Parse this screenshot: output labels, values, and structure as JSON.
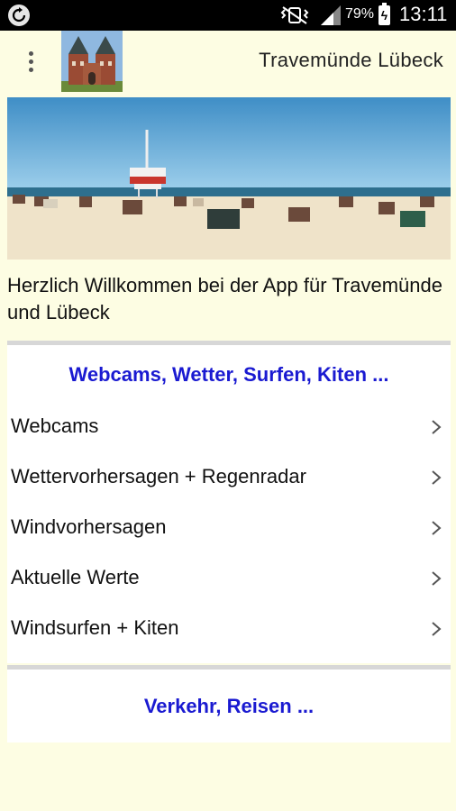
{
  "status_bar": {
    "app_icon": "sync-icon",
    "mute_icon": "vibrate-mute-icon",
    "signal_icon": "signal-icon",
    "battery_percent": "79%",
    "time": "13:11"
  },
  "app_bar": {
    "menu_icon": "overflow-menu-icon",
    "logo_image": "holstentor-logo",
    "title": "Travemünde Lübeck"
  },
  "hero": {
    "image": "beach-with-lifeguard-tower"
  },
  "welcome_text": "Herzlich Willkommen bei der App für Travemünde und Lübeck",
  "sections": [
    {
      "title": "Webcams, Wetter, Surfen, Kiten ...",
      "items": [
        {
          "label": "Webcams"
        },
        {
          "label": "Wettervorhersagen + Regenradar"
        },
        {
          "label": "Windvorhersagen"
        },
        {
          "label": "Aktuelle Werte"
        },
        {
          "label": "Windsurfen + Kiten"
        }
      ]
    },
    {
      "title": "Verkehr, Reisen ..."
    }
  ],
  "colors": {
    "background": "#fdfde3",
    "section_title": "#1a1ad1",
    "divider": "#d7d7d7"
  }
}
